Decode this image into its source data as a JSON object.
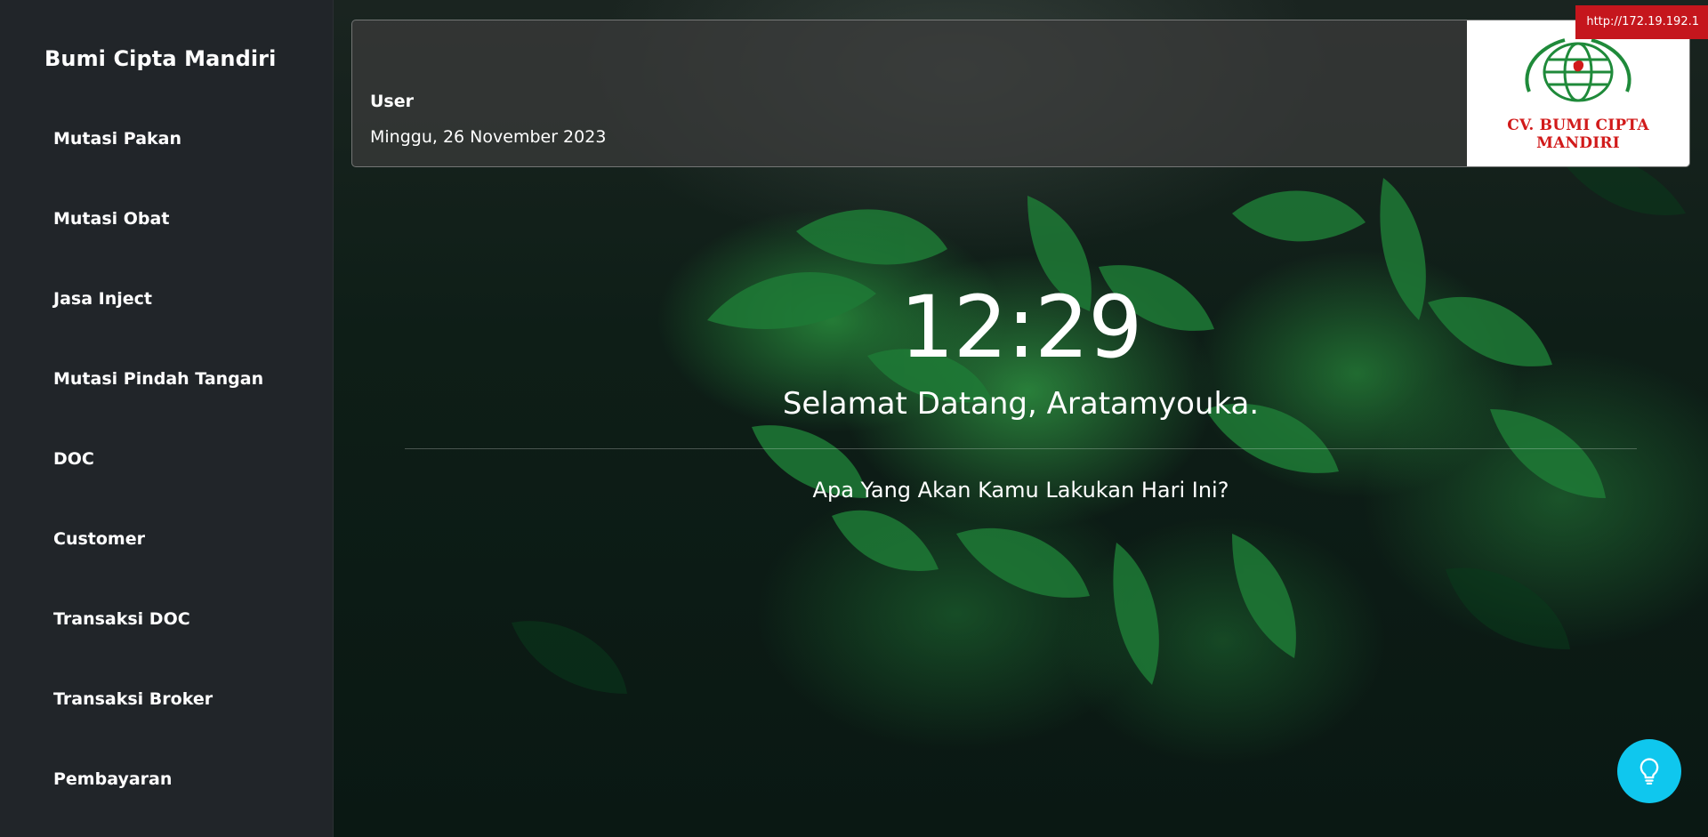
{
  "sidebar": {
    "brand": "Bumi Cipta Mandiri",
    "items": [
      {
        "label": "Mutasi Pakan"
      },
      {
        "label": "Mutasi Obat"
      },
      {
        "label": "Jasa Inject"
      },
      {
        "label": "Mutasi Pindah Tangan"
      },
      {
        "label": "DOC"
      },
      {
        "label": "Customer"
      },
      {
        "label": "Transaksi DOC"
      },
      {
        "label": "Transaksi Broker"
      },
      {
        "label": "Pembayaran"
      }
    ]
  },
  "header": {
    "user_label": "User",
    "date_text": "Minggu, 26 November 2023",
    "logo_text": "CV. BUMI CIPTA MANDIRI"
  },
  "url_badge": "http://172.19.192.1",
  "main": {
    "clock": "12:29",
    "welcome": "Selamat Datang, Aratamyouka.",
    "question": "Apa Yang Akan Kamu Lakukan Hari Ini?"
  },
  "tip_button": {
    "icon": "lightbulb-icon"
  },
  "colors": {
    "sidebar_bg": "#212529",
    "url_badge_bg": "#c5161d",
    "tip_button_bg": "#0fc7ee",
    "logo_red": "#d11a1a",
    "logo_green": "#1f8a3a"
  }
}
